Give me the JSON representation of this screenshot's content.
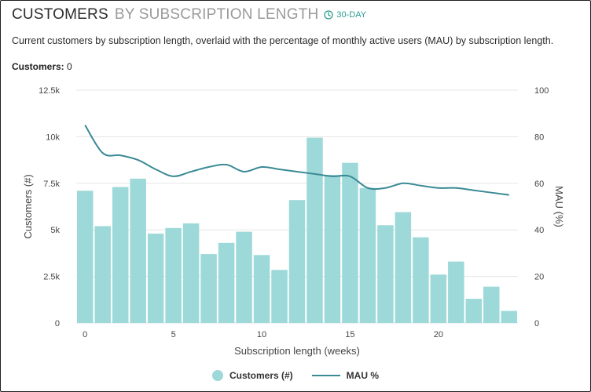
{
  "header": {
    "title_main": "CUSTOMERS",
    "title_sub": "BY SUBSCRIPTION LENGTH",
    "badge": "30-DAY",
    "badge_icon": "clock-icon"
  },
  "description": "Current customers by subscription length, overlaid with the percentage of monthly active users (MAU) by subscription length.",
  "stat": {
    "label": "Customers:",
    "value": "0"
  },
  "colors": {
    "bar": "#9dd9d9",
    "line": "#3a8a95",
    "accent": "#2a9d8f",
    "grid": "#e6e6e6"
  },
  "legend": [
    {
      "label": "Customers (#)",
      "marker": "circle"
    },
    {
      "label": "MAU %",
      "marker": "line"
    }
  ],
  "chart_data": {
    "type": "bar",
    "xlabel": "Subscription length (weeks)",
    "ylabel": "Customers (#)",
    "y2label": "MAU (%)",
    "xlim": [
      -0.5,
      24.5
    ],
    "ylim": [
      0,
      12500
    ],
    "y2lim": [
      0,
      100
    ],
    "grid": true,
    "x_ticks": [
      0,
      5,
      10,
      15,
      20
    ],
    "y_ticks": [
      0,
      2500,
      5000,
      7500,
      10000,
      12500
    ],
    "y_tick_labels": [
      "0",
      "2.5k",
      "5k",
      "7.5k",
      "10k",
      "12.5k"
    ],
    "y2_ticks": [
      0,
      20,
      40,
      60,
      80,
      100
    ],
    "x": [
      0,
      1,
      2,
      3,
      4,
      5,
      6,
      7,
      8,
      9,
      10,
      11,
      12,
      13,
      14,
      15,
      16,
      17,
      18,
      19,
      20,
      21,
      22,
      23,
      24
    ],
    "series": [
      {
        "name": "Customers (#)",
        "type": "bar",
        "axis": "left",
        "values": [
          7100,
          5200,
          7300,
          7750,
          4800,
          5100,
          5350,
          3700,
          4300,
          4900,
          3650,
          2850,
          6600,
          9950,
          7950,
          8600,
          7250,
          5250,
          5950,
          4600,
          2600,
          3300,
          1300,
          1950,
          650
        ]
      },
      {
        "name": "MAU %",
        "type": "line",
        "axis": "right",
        "values": [
          85,
          73,
          72,
          70,
          66,
          63,
          65,
          67,
          68,
          65,
          67,
          66,
          65,
          64,
          63,
          63,
          58,
          58,
          60,
          59,
          58,
          58,
          57,
          56,
          55
        ]
      }
    ]
  }
}
